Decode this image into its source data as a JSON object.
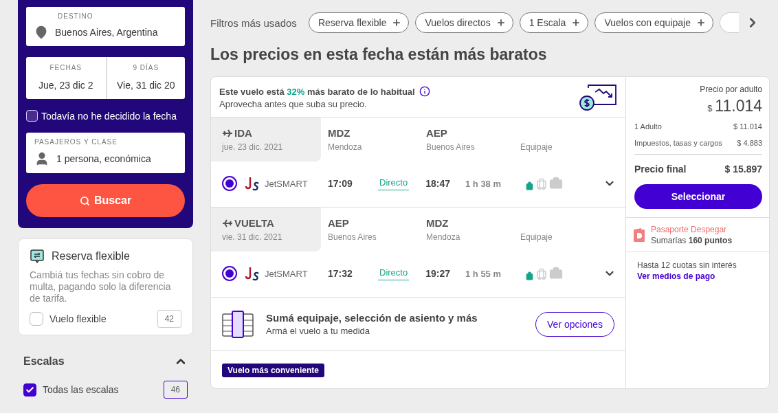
{
  "search_panel": {
    "destination": {
      "label": "DESTINO",
      "value": "Buenos Aires, Argentina"
    },
    "dates": [
      {
        "label": "FECHAS",
        "value": "Jue, 23 dic 2"
      },
      {
        "label": "9 DÍAS",
        "value": "Vie, 31 dic 20"
      }
    ],
    "undecided": {
      "label": "Todavía no he decidido la fecha",
      "checked": false
    },
    "passengers": {
      "label": "PASAJEROS Y CLASE",
      "value": "1 persona, económica"
    },
    "search_button": "Buscar"
  },
  "flexible_card": {
    "title": "Reserva flexible",
    "description": "Cambiá tus fechas sin cobro de multa, pagando solo la diferencia de tarifa.",
    "option": {
      "label": "Vuelo flexible",
      "count": "42",
      "checked": false
    }
  },
  "stops_filter": {
    "title": "Escalas",
    "expanded": true,
    "options": [
      {
        "label": "Todas las escalas",
        "count": "46",
        "checked": true
      }
    ]
  },
  "quick_filters": {
    "label": "Filtros más usados",
    "chips": [
      {
        "label": "Reserva flexible"
      },
      {
        "label": "Vuelos directos"
      },
      {
        "label": "1 Escala"
      },
      {
        "label": "Vuelos con equipaje"
      }
    ]
  },
  "heading": "Los precios en esta fecha están más baratos",
  "result": {
    "banner": {
      "before": "Este vuelo está",
      "percent": "32%",
      "after": "más barato de lo habitual",
      "subtitle": "Aprovecha antes que suba su precio."
    },
    "legs": [
      {
        "kind": "outbound",
        "direction": "IDA",
        "date": "jue. 23 dic. 2021",
        "origin": {
          "code": "MDZ",
          "city": "Mendoza"
        },
        "destination": {
          "code": "AEP",
          "city": "Buenos Aires"
        },
        "baggage_label": "Equipaje",
        "airline": "JetSMART",
        "selected": true,
        "departure": "17:09",
        "stops": "Directo",
        "arrival": "18:47",
        "duration": "1 h 38 m",
        "baggage": [
          {
            "kind": "personal",
            "included": true
          },
          {
            "kind": "carry-on",
            "included": false
          },
          {
            "kind": "checked",
            "included": false
          }
        ]
      },
      {
        "kind": "return",
        "direction": "VUELTA",
        "date": "vie. 31 dic. 2021",
        "origin": {
          "code": "AEP",
          "city": "Buenos Aires"
        },
        "destination": {
          "code": "MDZ",
          "city": "Mendoza"
        },
        "baggage_label": "Equipaje",
        "airline": "JetSMART",
        "selected": true,
        "departure": "17:32",
        "stops": "Directo",
        "arrival": "19:27",
        "duration": "1 h 55 m",
        "baggage": [
          {
            "kind": "personal",
            "included": true
          },
          {
            "kind": "carry-on",
            "included": false
          },
          {
            "kind": "checked",
            "included": false
          }
        ]
      }
    ],
    "extras": {
      "title": "Sumá equipaje, selección de asiento y más",
      "subtitle": "Armá el vuelo a tu medida",
      "button": "Ver opciones"
    },
    "badge": "Vuelo más conveniente",
    "price": {
      "label": "Precio por adulto",
      "currency": "$",
      "amount": "11.014",
      "lines": [
        {
          "label": "1 Adulto",
          "value": "$ 11.014"
        },
        {
          "label": "Impuestos, tasas y cargos",
          "value": "$ 4.883"
        }
      ],
      "total_label": "Precio final",
      "total": "$ 15.897",
      "button": "Seleccionar",
      "loyalty": {
        "title": "Pasaporte Despegar",
        "before": "Sumarías",
        "points": "160 puntos"
      },
      "installments": "Hasta 12 cuotas sin interés",
      "payment_link": "Ver medios de pago"
    }
  }
}
